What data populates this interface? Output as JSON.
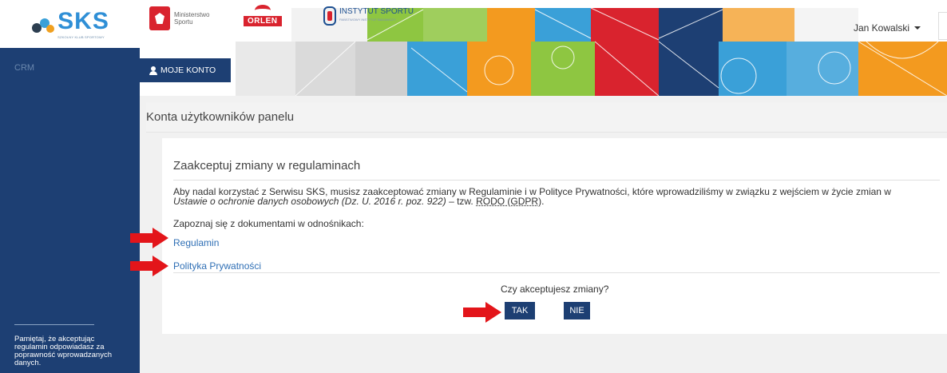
{
  "brand": {
    "logo_text": "SKS",
    "logo_sub": "SZKOLNY KLUB SPORTOWY"
  },
  "sidebar": {
    "crm_label": "CRM",
    "note": "Pamiętaj, że akceptując regulamin odpowiadasz za poprawność wprowadzanych danych."
  },
  "header": {
    "partners": {
      "ministry": "Ministerstwo Sportu",
      "orlen": "ORLEN",
      "instytut": "INSTYTUT SPORTU",
      "instytut_sub": "PAŃSTWOWY INSTYTUT BADAWCZY"
    },
    "user_name": "Jan Kowalski",
    "account_button": "MOJE KONTO"
  },
  "page": {
    "title": "Konta użytkowników panelu",
    "panel": {
      "title": "Zaakceptuj zmiany w regulaminach",
      "body_1": "Aby nadal korzystać z Serwisu SKS, musisz zaakceptować zmiany w Regulaminie i w Polityce Prywatności, które wprowadziliśmy w związku z wejściem w życie zmian w",
      "body_italic": "Ustawie o ochronie danych osobowych (Dz. U. 2016 r. poz. 922)",
      "body_2": " – tzw. ",
      "body_abbr": "RODO (GDPR)",
      "body_3": ".",
      "links_intro": "Zapoznaj się z dokumentami w odnośnikach:",
      "link_regulamin": "Regulamin",
      "link_polityka": "Polityka Prywatności",
      "question": "Czy akceptujesz zmiany?",
      "yes_label": "TAK",
      "no_label": "NIE"
    }
  },
  "colors": {
    "navy": "#1d3f73",
    "link": "#2f6fb5",
    "annotation_red": "#e3151a",
    "banner": [
      "#f0f0f0",
      "#8ec641",
      "#d9232e",
      "#1d3f73",
      "#f39a1f",
      "#3aa0d8"
    ]
  }
}
